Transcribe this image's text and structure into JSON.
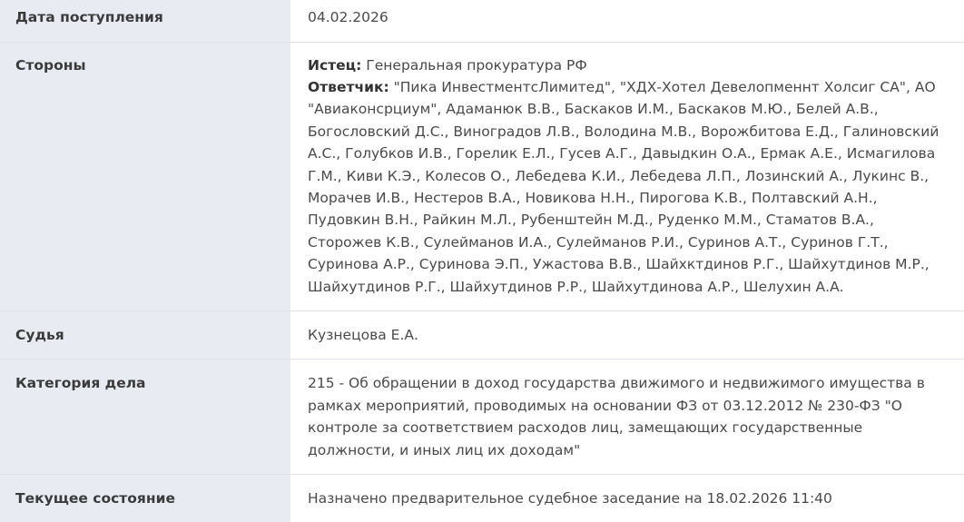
{
  "rows": {
    "receipt_date": {
      "label": "Дата поступления",
      "value": "04.02.2026"
    },
    "parties": {
      "label": "Стороны",
      "plaintiff_role": "Истец:",
      "plaintiff": "Генеральная прокуратура РФ",
      "defendant_role": "Ответчик:",
      "defendant": "\"Пика ИнвестментсЛимитед\", \"ХДХ-Хотел Девелопменнт Холсиг СА\", АО \"Авиаконсрциум\", Адаманюк В.В., Баскаков И.М., Баскаков М.Ю., Белей А.В., Богословский Д.С., Виноградов Л.В., Володина М.В., Ворожбитова Е.Д., Галиновский А.С., Голубков И.В., Горелик Е.Л., Гусев А.Г., Давыдкин О.А., Ермак А.Е., Исмагилова Г.М., Киви К.Э., Колесов О., Лебедева К.И., Лебедева Л.П., Лозинский А., Лукинс В., Морачев И.В., Нестеров В.А., Новикова Н.Н., Пирогова К.В., Полтавский А.Н., Пудовкин В.Н., Райкин М.Л., Рубенштейн М.Д., Руденко М.М., Стаматов В.А., Сторожев К.В., Сулейманов И.А., Сулейманов Р.И., Суринов А.Т., Суринов Г.Т., Суринова А.Р., Суринова Э.П., Ужастова В.В., Шайхктдинов Р.Г., Шайхутдинов М.Р., Шайхутдинов Р.Г., Шайхутдинов Р.Р., Шайхутдинова А.Р., Шелухин А.А."
    },
    "judge": {
      "label": "Судья",
      "value": "Кузнецова Е.А."
    },
    "category": {
      "label": "Категория дела",
      "value": "215 - Об обращении в доход государства движимого и недвижимого имущества в рамках мероприятий, проводимых на основании ФЗ от 03.12.2012 № 230-ФЗ \"О контроле за соответствием расходов лиц, замещающих государственные должности, и иных лиц их доходам\""
    },
    "status": {
      "label": "Текущее состояние",
      "value": "Назначено предварительное судебное заседание на 18.02.2026 11:40"
    }
  }
}
